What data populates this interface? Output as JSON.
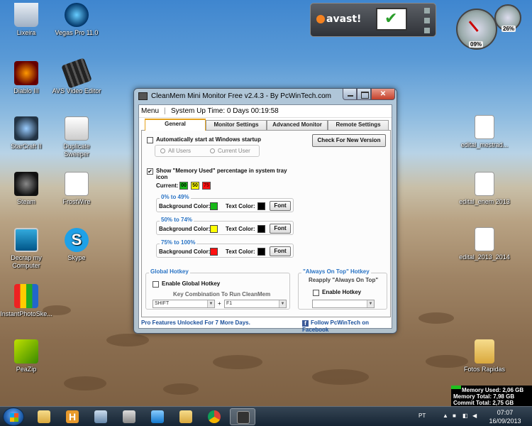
{
  "desktop": {
    "icons": [
      {
        "label": "Lixeira",
        "icon": "recycle-bin-icon"
      },
      {
        "label": "Vegas Pro 11.0",
        "icon": "vegas-icon"
      },
      {
        "label": "Diablo III",
        "icon": "diablo-icon"
      },
      {
        "label": "AVS Video Editor",
        "icon": "film-icon"
      },
      {
        "label": "StarCraft II",
        "icon": "starcraft-icon"
      },
      {
        "label": "Duplicate Sweeper",
        "icon": "sweeper-icon"
      },
      {
        "label": "Steam",
        "icon": "steam-icon"
      },
      {
        "label": "FrostWire",
        "icon": "frostwire-icon"
      },
      {
        "label": "Decrap my Computer",
        "icon": "decrap-icon"
      },
      {
        "label": "Skype",
        "icon": "skype-icon"
      },
      {
        "label": "InstantPhotoSke...",
        "icon": "pencils-icon"
      },
      {
        "label": "PeaZip",
        "icon": "peazip-icon"
      },
      {
        "label": "edital_mestrad...",
        "icon": "pdf-icon"
      },
      {
        "label": "edital_enem 2013",
        "icon": "pdf-icon"
      },
      {
        "label": "edital_2013_2014",
        "icon": "pdf-icon"
      },
      {
        "label": "Fotos Rapidas",
        "icon": "folder-icon"
      }
    ]
  },
  "gadgets": {
    "avast_logo": "avast!",
    "meter_cpu": "09%",
    "meter_ram": "26%"
  },
  "window": {
    "title": "CleanMem Mini Monitor Free v2.4.3 - By PcWinTech.com",
    "menu_label": "Menu",
    "menu_sep": "|",
    "uptime": "System Up Time: 0 Days 00:19:58",
    "tabs": [
      "General",
      "Monitor Settings",
      "Advanced Monitor",
      "Remote Settings"
    ],
    "general": {
      "autostart_label": "Automatically start at Windows startup",
      "all_users": "All Users",
      "current_user": "Current User",
      "check_version": "Check For New Version",
      "show_memory_label": "Show \"Memory Used\" percentage in system tray icon",
      "current_label": "Current:",
      "current_values": [
        "00",
        "50",
        "75"
      ],
      "ranges": [
        {
          "title": "0% to 49%",
          "bg_label": "Background Color:",
          "bg_color": "#17b817",
          "text_label": "Text Color:",
          "text_color": "#000000",
          "font_btn": "Font"
        },
        {
          "title": "50% to 74%",
          "bg_label": "Background Color:",
          "bg_color": "#ffff00",
          "text_label": "Text Color:",
          "text_color": "#000000",
          "font_btn": "Font"
        },
        {
          "title": "75% to 100%",
          "bg_label": "Background Color:",
          "bg_color": "#ff1010",
          "text_label": "Text Color:",
          "text_color": "#000000",
          "font_btn": "Font"
        }
      ],
      "global_hotkey": {
        "title": "Global Hotkey",
        "enable_label": "Enable Global Hotkey",
        "combo_label": "Key Combination To Run CleanMem",
        "modifier": "SHIFT",
        "plus": "+",
        "key": "F1"
      },
      "always_on_top": {
        "title": "\"Always On Top\" Hotkey",
        "reapply": "Reapply \"Always On Top\"",
        "enable_label": "Enable Hotkey",
        "key": ""
      }
    },
    "footer_left": "Pro Features Unlocked For 7 More Days.",
    "footer_right": "Follow PcWinTech on Facebook"
  },
  "memory_widget": {
    "used": "Memory Used: 2,06 GB",
    "total": "Memory Total: 7,98 GB",
    "commit": "Commit Total: 2,75 GB"
  },
  "taskbar": {
    "lang": "PT",
    "time": "07:07",
    "date": "16/09/2013"
  }
}
